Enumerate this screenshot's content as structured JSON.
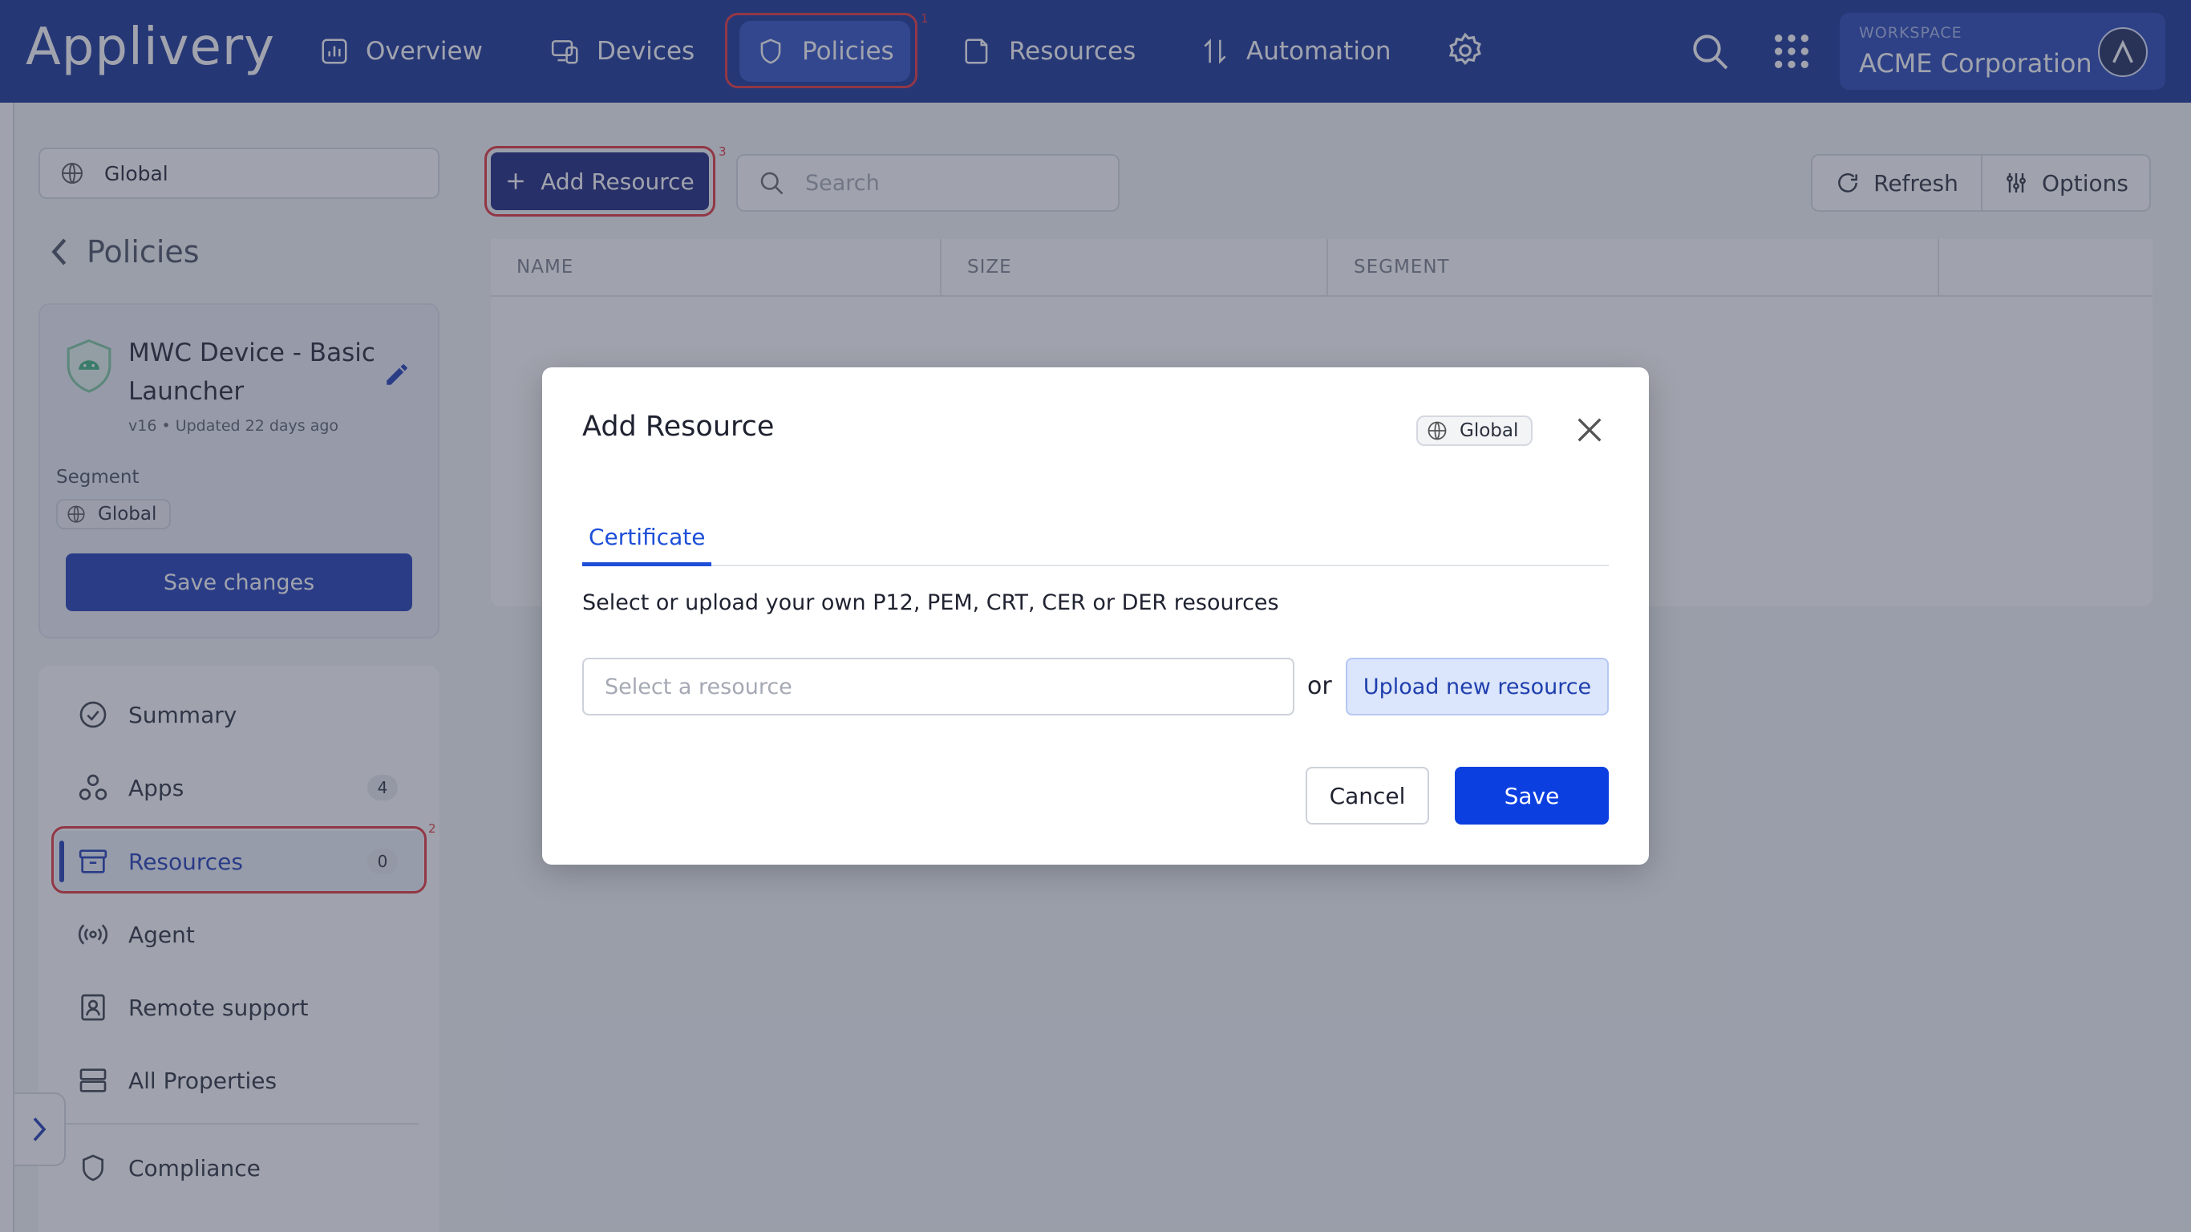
{
  "app": {
    "name": "Applivery"
  },
  "nav": {
    "items": [
      {
        "label": "Overview",
        "icon": "chart-icon"
      },
      {
        "label": "Devices",
        "icon": "devices-icon"
      },
      {
        "label": "Policies",
        "icon": "shield-icon",
        "active": true
      },
      {
        "label": "Resources",
        "icon": "folder-icon"
      },
      {
        "label": "Automation",
        "icon": "automation-icon"
      }
    ],
    "settings_icon": "gear-icon",
    "search_icon": "search-icon",
    "apps_icon": "grid-icon"
  },
  "workspace": {
    "caption": "WORKSPACE",
    "name": "ACME Corporation",
    "avatar": "A"
  },
  "markers": {
    "policies": "1",
    "resources_menu": "2",
    "add_resource": "3"
  },
  "scope_selector": {
    "value": "Global"
  },
  "sidebar": {
    "back_label": "Policies",
    "policy": {
      "name": "MWC Device - Basic Launcher",
      "meta": "v16 • Updated 22 days ago",
      "segment_label": "Segment",
      "segment_value": "Global",
      "save_label": "Save changes"
    },
    "menu": [
      {
        "label": "Summary",
        "icon": "check-circle-icon"
      },
      {
        "label": "Apps",
        "icon": "apps-icon",
        "count": "4"
      },
      {
        "label": "Resources",
        "icon": "archive-icon",
        "count": "0",
        "active": true
      },
      {
        "label": "Agent",
        "icon": "broadcast-icon"
      },
      {
        "label": "Remote support",
        "icon": "id-badge-icon"
      },
      {
        "label": "All Properties",
        "icon": "stack-icon"
      },
      {
        "label": "Compliance",
        "icon": "shield-outline-icon"
      }
    ]
  },
  "toolbar": {
    "add_resource_label": "Add Resource",
    "search_placeholder": "Search",
    "refresh_label": "Refresh",
    "options_label": "Options"
  },
  "table": {
    "columns": [
      "NAME",
      "SIZE",
      "SEGMENT",
      ""
    ]
  },
  "modal": {
    "title": "Add Resource",
    "scope_chip": "Global",
    "tab": "Certificate",
    "description": "Select or upload your own P12, PEM, CRT, CER or DER resources",
    "select_placeholder": "Select a resource",
    "or_label": "or",
    "upload_label": "Upload new resource",
    "cancel_label": "Cancel",
    "save_label": "Save"
  },
  "colors": {
    "nav_bg": "#163196",
    "primary": "#1d3bb5",
    "save": "#0b3fe0",
    "marker": "#e5303a"
  }
}
